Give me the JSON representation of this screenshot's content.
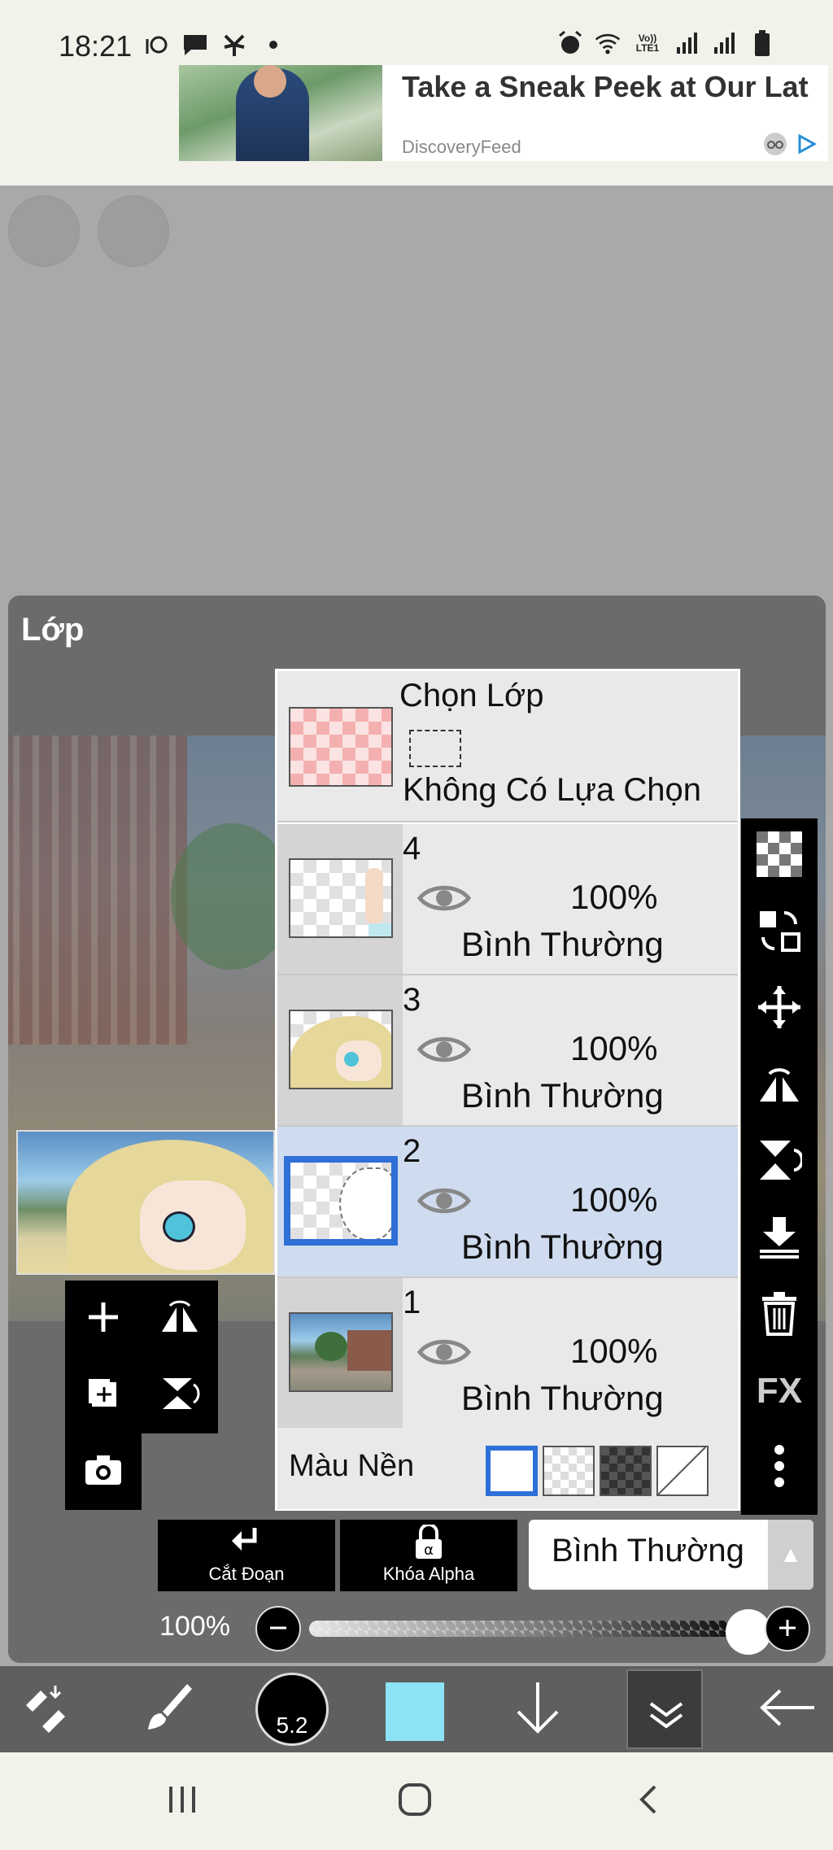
{
  "status_bar": {
    "time": "18:21",
    "left_icons": [
      "weather-icon",
      "message-icon",
      "pinwheel-icon",
      "dot-icon"
    ],
    "right_icons": [
      "alarm-icon",
      "wifi-icon",
      "volte-icon",
      "signal-icon",
      "signal-icon",
      "battery-icon"
    ],
    "volte_label": "Vo)) LTE1"
  },
  "ad": {
    "title": "Take a Sneak Peek at Our Latest Recommendations...",
    "source": "DiscoveryFeed",
    "accent": "#2a8fd6"
  },
  "panel": {
    "title": "Lớp"
  },
  "selection_layer": {
    "title": "Chọn Lớp",
    "subtitle": "Không Có Lựa Chọn"
  },
  "layers": [
    {
      "number": "4",
      "opacity": "100%",
      "blend": "Bình Thường",
      "active": false
    },
    {
      "number": "3",
      "opacity": "100%",
      "blend": "Bình Thường",
      "active": false
    },
    {
      "number": "2",
      "opacity": "100%",
      "blend": "Bình Thường",
      "active": true
    },
    {
      "number": "1",
      "opacity": "100%",
      "blend": "Bình Thường",
      "active": false
    }
  ],
  "background": {
    "label": "Màu Nền",
    "options": [
      "white",
      "transparent",
      "dark-checker",
      "none"
    ],
    "selected": "white"
  },
  "right_toolbar": {
    "fx_label": "FX",
    "items": [
      "checker-icon",
      "swap-layer-icon",
      "move-icon",
      "flip-horizontal-icon",
      "flip-vertical-icon",
      "merge-down-icon",
      "trash-icon",
      "fx-icon",
      "more-icon"
    ]
  },
  "controls": {
    "clip_label": "Cắt Đoạn",
    "alpha_lock_label": "Khóa Alpha",
    "blend_mode": "Bình Thường",
    "opacity_label": "100%",
    "opacity_value": 1.0
  },
  "bottom_toolbar": {
    "brush_size": "5.2",
    "current_color": "#8be3f5"
  },
  "colors": {
    "active_layer_bg": "#cfdcef",
    "active_border": "#2e6fd8"
  }
}
